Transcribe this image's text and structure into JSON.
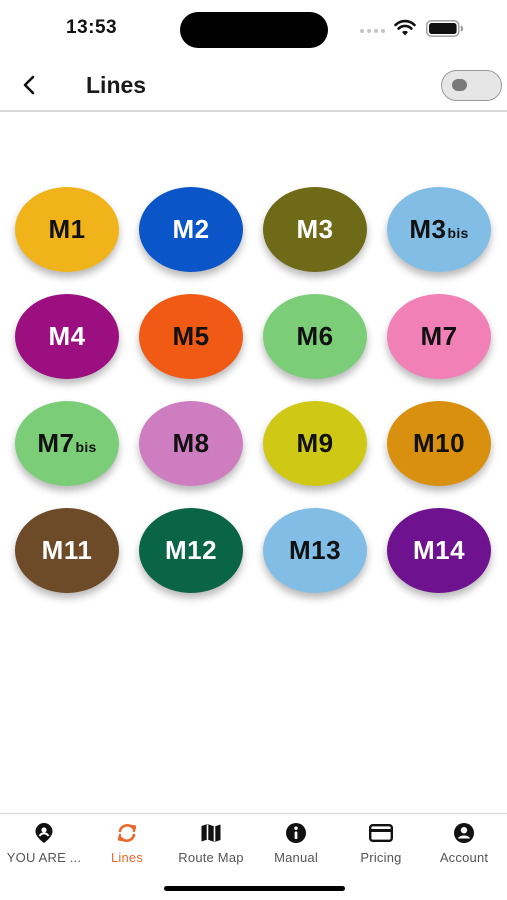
{
  "status_bar": {
    "time": "13:53"
  },
  "header": {
    "title": "Lines",
    "back_icon": "chevron-left-icon",
    "toggle_state": "off"
  },
  "lines": [
    {
      "code": "M1",
      "suffix": "",
      "bg": "#f0b41a",
      "fg": "#111111"
    },
    {
      "code": "M2",
      "suffix": "",
      "bg": "#0a55c8",
      "fg": "#ffffff"
    },
    {
      "code": "M3",
      "suffix": "",
      "bg": "#6e6a18",
      "fg": "#ffffff"
    },
    {
      "code": "M3",
      "suffix": "bis",
      "bg": "#82bde6",
      "fg": "#111111"
    },
    {
      "code": "M4",
      "suffix": "",
      "bg": "#9b0f80",
      "fg": "#ffffff"
    },
    {
      "code": "M5",
      "suffix": "",
      "bg": "#f05a14",
      "fg": "#111111"
    },
    {
      "code": "M6",
      "suffix": "",
      "bg": "#7ccd78",
      "fg": "#111111"
    },
    {
      "code": "M7",
      "suffix": "",
      "bg": "#f080b6",
      "fg": "#111111"
    },
    {
      "code": "M7",
      "suffix": "bis",
      "bg": "#7ccd78",
      "fg": "#111111"
    },
    {
      "code": "M8",
      "suffix": "",
      "bg": "#ce7ec0",
      "fg": "#111111"
    },
    {
      "code": "M9",
      "suffix": "",
      "bg": "#cfc814",
      "fg": "#111111"
    },
    {
      "code": "M10",
      "suffix": "",
      "bg": "#d8900e",
      "fg": "#111111"
    },
    {
      "code": "M11",
      "suffix": "",
      "bg": "#6d4a28",
      "fg": "#ffffff"
    },
    {
      "code": "M12",
      "suffix": "",
      "bg": "#0a6446",
      "fg": "#ffffff"
    },
    {
      "code": "M13",
      "suffix": "",
      "bg": "#82bde6",
      "fg": "#111111"
    },
    {
      "code": "M14",
      "suffix": "",
      "bg": "#6e1290",
      "fg": "#ffffff"
    }
  ],
  "tab_bar": {
    "active": "Lines",
    "accent": "#e8692c",
    "tabs": [
      {
        "label": "YOU ARE ...",
        "icon": "location-pin-icon"
      },
      {
        "label": "Lines",
        "icon": "refresh-icon"
      },
      {
        "label": "Route Map",
        "icon": "map-icon"
      },
      {
        "label": "Manual",
        "icon": "info-icon"
      },
      {
        "label": "Pricing",
        "icon": "credit-card-icon"
      },
      {
        "label": "Account",
        "icon": "account-icon"
      }
    ]
  }
}
